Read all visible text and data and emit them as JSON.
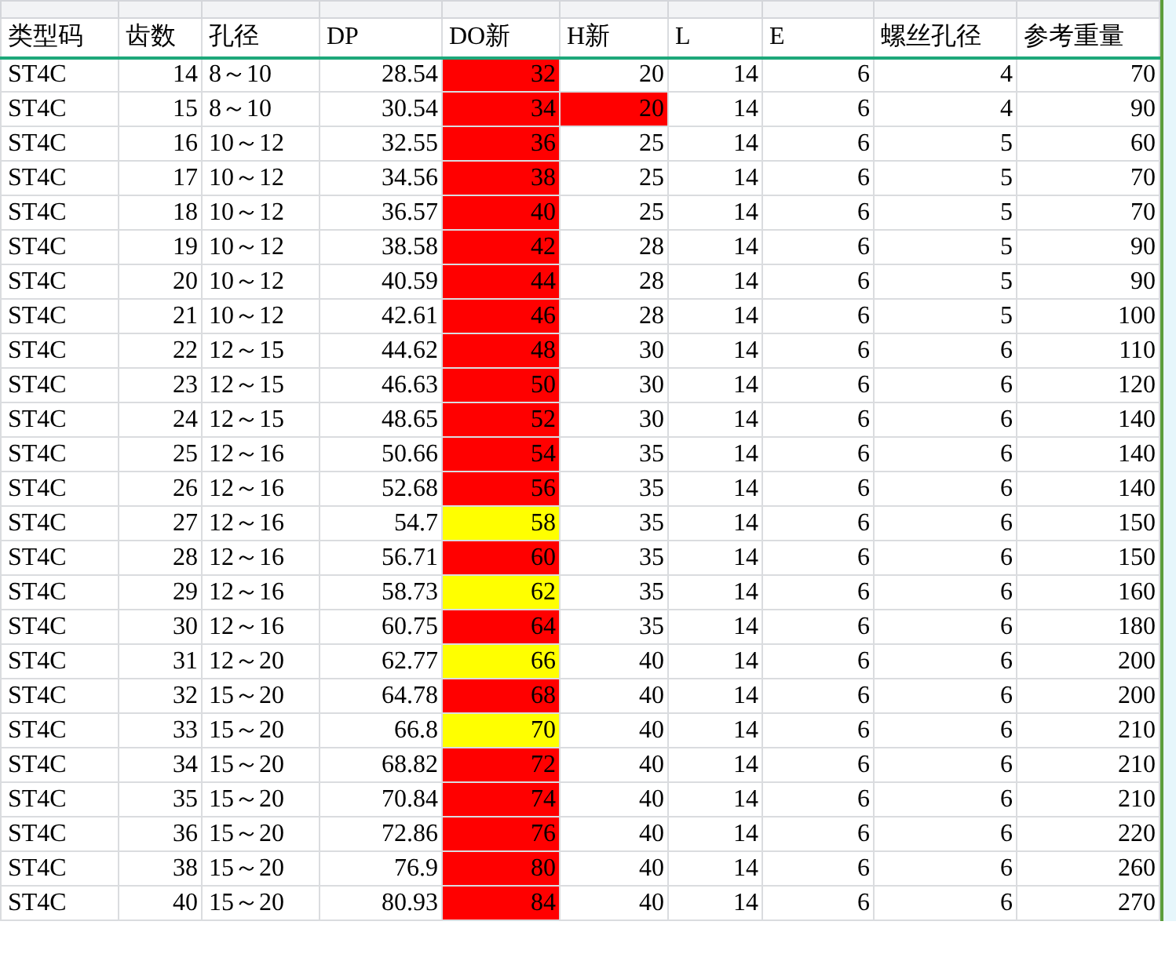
{
  "columns": [
    "类型码",
    "齿数",
    "孔径",
    "DP",
    "DO新",
    "H新",
    "L",
    "E",
    "螺丝孔径",
    "参考重量"
  ],
  "rows": [
    {
      "type": "ST4C",
      "teeth": "14",
      "bore": "8～10",
      "dp": "28.54",
      "do_new": {
        "text": "32",
        "color": "#ff0000"
      },
      "h_new": {
        "text": "20"
      },
      "l": "14",
      "e": "6",
      "screw": "4",
      "weight": "70"
    },
    {
      "type": "ST4C",
      "teeth": "15",
      "bore": "8～10",
      "dp": "30.54",
      "do_new": {
        "text": "34",
        "color": "#ff0000"
      },
      "h_new": {
        "text": "20",
        "color": "#ff0000"
      },
      "l": "14",
      "e": "6",
      "screw": "4",
      "weight": "90"
    },
    {
      "type": "ST4C",
      "teeth": "16",
      "bore": "10～12",
      "dp": "32.55",
      "do_new": {
        "text": "36",
        "color": "#ff0000"
      },
      "h_new": {
        "text": "25"
      },
      "l": "14",
      "e": "6",
      "screw": "5",
      "weight": "60"
    },
    {
      "type": "ST4C",
      "teeth": "17",
      "bore": "10～12",
      "dp": "34.56",
      "do_new": {
        "text": "38",
        "color": "#ff0000"
      },
      "h_new": {
        "text": "25"
      },
      "l": "14",
      "e": "6",
      "screw": "5",
      "weight": "70"
    },
    {
      "type": "ST4C",
      "teeth": "18",
      "bore": "10～12",
      "dp": "36.57",
      "do_new": {
        "text": "40",
        "color": "#ff0000"
      },
      "h_new": {
        "text": "25"
      },
      "l": "14",
      "e": "6",
      "screw": "5",
      "weight": "70"
    },
    {
      "type": "ST4C",
      "teeth": "19",
      "bore": "10～12",
      "dp": "38.58",
      "do_new": {
        "text": "42",
        "color": "#ff0000"
      },
      "h_new": {
        "text": "28"
      },
      "l": "14",
      "e": "6",
      "screw": "5",
      "weight": "90"
    },
    {
      "type": "ST4C",
      "teeth": "20",
      "bore": "10～12",
      "dp": "40.59",
      "do_new": {
        "text": "44",
        "color": "#ff0000"
      },
      "h_new": {
        "text": "28"
      },
      "l": "14",
      "e": "6",
      "screw": "5",
      "weight": "90"
    },
    {
      "type": "ST4C",
      "teeth": "21",
      "bore": "10～12",
      "dp": "42.61",
      "do_new": {
        "text": "46",
        "color": "#ff0000"
      },
      "h_new": {
        "text": "28"
      },
      "l": "14",
      "e": "6",
      "screw": "5",
      "weight": "100"
    },
    {
      "type": "ST4C",
      "teeth": "22",
      "bore": "12～15",
      "dp": "44.62",
      "do_new": {
        "text": "48",
        "color": "#ff0000"
      },
      "h_new": {
        "text": "30"
      },
      "l": "14",
      "e": "6",
      "screw": "6",
      "weight": "110"
    },
    {
      "type": "ST4C",
      "teeth": "23",
      "bore": "12～15",
      "dp": "46.63",
      "do_new": {
        "text": "50",
        "color": "#ff0000"
      },
      "h_new": {
        "text": "30"
      },
      "l": "14",
      "e": "6",
      "screw": "6",
      "weight": "120"
    },
    {
      "type": "ST4C",
      "teeth": "24",
      "bore": "12～15",
      "dp": "48.65",
      "do_new": {
        "text": "52",
        "color": "#ff0000"
      },
      "h_new": {
        "text": "30"
      },
      "l": "14",
      "e": "6",
      "screw": "6",
      "weight": "140"
    },
    {
      "type": "ST4C",
      "teeth": "25",
      "bore": "12～16",
      "dp": "50.66",
      "do_new": {
        "text": "54",
        "color": "#ff0000"
      },
      "h_new": {
        "text": "35"
      },
      "l": "14",
      "e": "6",
      "screw": "6",
      "weight": "140"
    },
    {
      "type": "ST4C",
      "teeth": "26",
      "bore": "12～16",
      "dp": "52.68",
      "do_new": {
        "text": "56",
        "color": "#ff0000"
      },
      "h_new": {
        "text": "35"
      },
      "l": "14",
      "e": "6",
      "screw": "6",
      "weight": "140"
    },
    {
      "type": "ST4C",
      "teeth": "27",
      "bore": "12～16",
      "dp": "54.7",
      "do_new": {
        "text": "58",
        "color": "#ffff00"
      },
      "h_new": {
        "text": "35"
      },
      "l": "14",
      "e": "6",
      "screw": "6",
      "weight": "150"
    },
    {
      "type": "ST4C",
      "teeth": "28",
      "bore": "12～16",
      "dp": "56.71",
      "do_new": {
        "text": "60",
        "color": "#ff0000"
      },
      "h_new": {
        "text": "35"
      },
      "l": "14",
      "e": "6",
      "screw": "6",
      "weight": "150"
    },
    {
      "type": "ST4C",
      "teeth": "29",
      "bore": "12～16",
      "dp": "58.73",
      "do_new": {
        "text": "62",
        "color": "#ffff00"
      },
      "h_new": {
        "text": "35"
      },
      "l": "14",
      "e": "6",
      "screw": "6",
      "weight": "160"
    },
    {
      "type": "ST4C",
      "teeth": "30",
      "bore": "12～16",
      "dp": "60.75",
      "do_new": {
        "text": "64",
        "color": "#ff0000"
      },
      "h_new": {
        "text": "35"
      },
      "l": "14",
      "e": "6",
      "screw": "6",
      "weight": "180"
    },
    {
      "type": "ST4C",
      "teeth": "31",
      "bore": "12～20",
      "dp": "62.77",
      "do_new": {
        "text": "66",
        "color": "#ffff00"
      },
      "h_new": {
        "text": "40"
      },
      "l": "14",
      "e": "6",
      "screw": "6",
      "weight": "200"
    },
    {
      "type": "ST4C",
      "teeth": "32",
      "bore": "15～20",
      "dp": "64.78",
      "do_new": {
        "text": "68",
        "color": "#ff0000"
      },
      "h_new": {
        "text": "40"
      },
      "l": "14",
      "e": "6",
      "screw": "6",
      "weight": "200"
    },
    {
      "type": "ST4C",
      "teeth": "33",
      "bore": "15～20",
      "dp": "66.8",
      "do_new": {
        "text": "70",
        "color": "#ffff00"
      },
      "h_new": {
        "text": "40"
      },
      "l": "14",
      "e": "6",
      "screw": "6",
      "weight": "210"
    },
    {
      "type": "ST4C",
      "teeth": "34",
      "bore": "15～20",
      "dp": "68.82",
      "do_new": {
        "text": "72",
        "color": "#ff0000"
      },
      "h_new": {
        "text": "40"
      },
      "l": "14",
      "e": "6",
      "screw": "6",
      "weight": "210"
    },
    {
      "type": "ST4C",
      "teeth": "35",
      "bore": "15～20",
      "dp": "70.84",
      "do_new": {
        "text": "74",
        "color": "#ff0000"
      },
      "h_new": {
        "text": "40"
      },
      "l": "14",
      "e": "6",
      "screw": "6",
      "weight": "210"
    },
    {
      "type": "ST4C",
      "teeth": "36",
      "bore": "15～20",
      "dp": "72.86",
      "do_new": {
        "text": "76",
        "color": "#ff0000"
      },
      "h_new": {
        "text": "40"
      },
      "l": "14",
      "e": "6",
      "screw": "6",
      "weight": "220"
    },
    {
      "type": "ST4C",
      "teeth": "38",
      "bore": "15～20",
      "dp": "76.9",
      "do_new": {
        "text": "80",
        "color": "#ff0000"
      },
      "h_new": {
        "text": "40"
      },
      "l": "14",
      "e": "6",
      "screw": "6",
      "weight": "260"
    },
    {
      "type": "ST4C",
      "teeth": "40",
      "bore": "15～20",
      "dp": "80.93",
      "do_new": {
        "text": "84",
        "color": "#ff0000"
      },
      "h_new": {
        "text": "40"
      },
      "l": "14",
      "e": "6",
      "screw": "6",
      "weight": "270"
    }
  ]
}
